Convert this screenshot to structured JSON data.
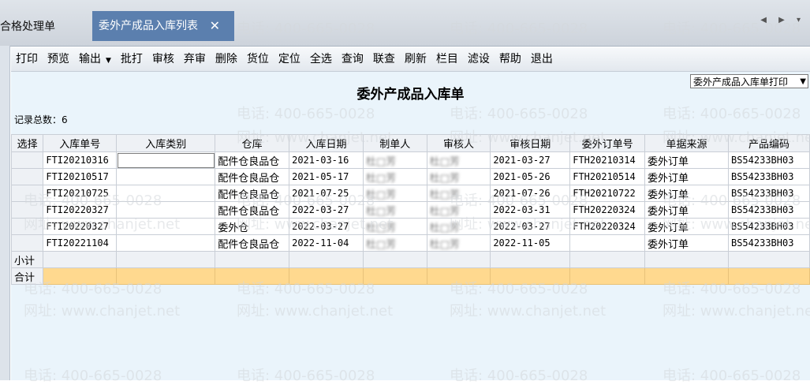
{
  "tabs": {
    "inactive_label": "合格处理单",
    "active_label": "委外产成品入库列表",
    "close_glyph": "✕",
    "nav_arrows": "◀ ▶ ▾"
  },
  "toolbar": {
    "items": [
      "打印",
      "预览",
      "输出",
      "批打",
      "审核",
      "弃审",
      "删除",
      "货位",
      "定位",
      "全选",
      "查询",
      "联查",
      "刷新",
      "栏目",
      "滤设",
      "帮助",
      "退出"
    ],
    "dropdown_index": 2,
    "dropdown_arrow": "▼"
  },
  "report": {
    "title": "委外产成品入库单",
    "template_select": "委外产成品入库单打印",
    "record_count": "记录总数：6"
  },
  "table": {
    "headers": [
      "选择",
      "入库单号",
      "入库类别",
      "仓库",
      "入库日期",
      "制单人",
      "审核人",
      "审核日期",
      "委外订单号",
      "单据来源",
      "产品编码"
    ],
    "rows": [
      [
        "",
        "FTI20210316",
        "",
        "配件仓良品仓",
        "2021-03-16",
        "杜□芳",
        "杜□芳",
        "2021-03-27",
        "FTH20210314",
        "委外订单",
        "BS54233BH03"
      ],
      [
        "",
        "FTI20210517",
        "",
        "配件仓良品仓",
        "2021-05-17",
        "杜□芳",
        "杜□芳",
        "2021-05-26",
        "FTH20210514",
        "委外订单",
        "BS54233BH03"
      ],
      [
        "",
        "FTI20210725",
        "",
        "配件仓良品仓",
        "2021-07-25",
        "杜□芳",
        "杜□芳",
        "2021-07-26",
        "FTH20210722",
        "委外订单",
        "BS54233BH03"
      ],
      [
        "",
        "FTI20220327",
        "",
        "配件仓良品仓",
        "2022-03-27",
        "杜□芳",
        "杜□芳",
        "2022-03-31",
        "FTH20220324",
        "委外订单",
        "BS54233BH03"
      ],
      [
        "",
        "FTI20220327",
        "",
        "委外仓",
        "2022-03-27",
        "杜□芳",
        "杜□芳",
        "2022-03-27",
        "FTH20220324",
        "委外订单",
        "BS54233BH03"
      ],
      [
        "",
        "FTI20221104",
        "",
        "配件仓良品仓",
        "2022-11-04",
        "杜□芳",
        "杜□芳",
        "2022-11-05",
        "",
        "委外订单",
        "BS54233BH03"
      ]
    ],
    "subtotal_label": "小计",
    "total_label": "合计"
  },
  "watermark": {
    "phone": "电话: 400-665-0028",
    "site": "网址: www.chanjet.net"
  },
  "colors": {
    "active_tab": "#5b7fae",
    "report_bg": "#eaf4fb",
    "total_row": "#ffd98f"
  }
}
